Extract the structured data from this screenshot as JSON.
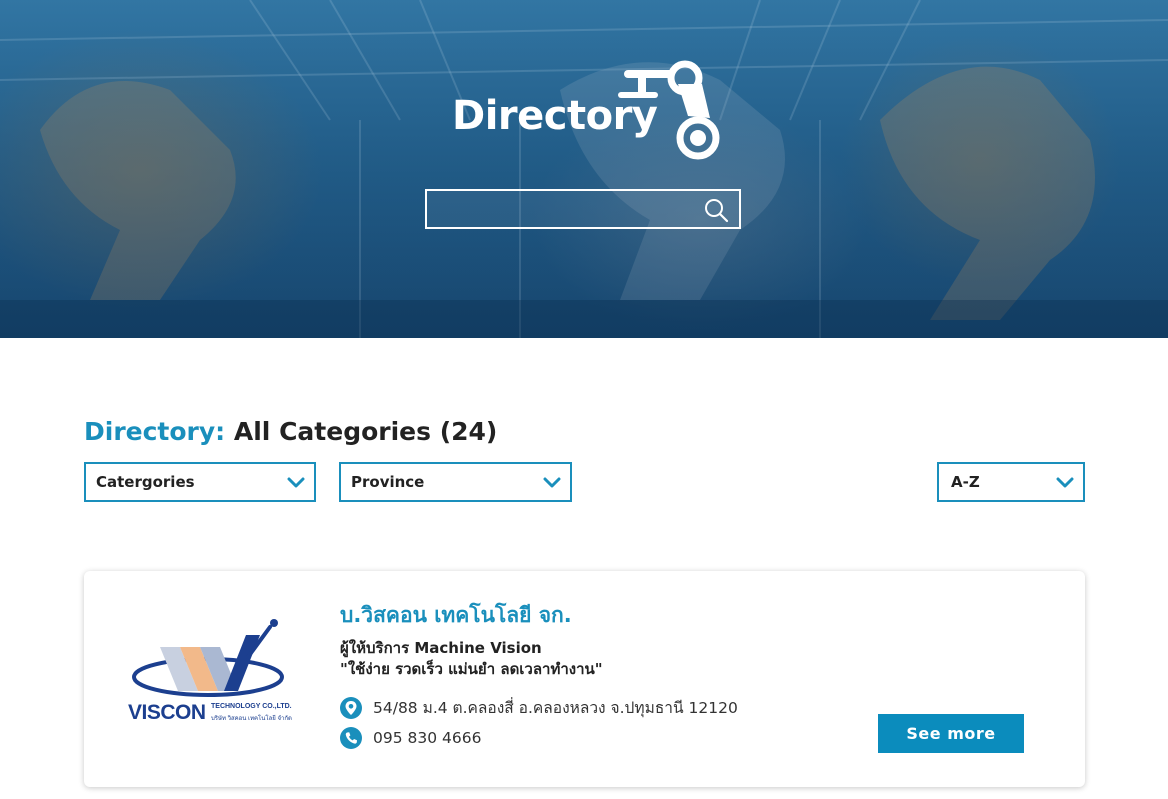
{
  "hero": {
    "title": "Directory",
    "search": {
      "value": "",
      "placeholder": ""
    }
  },
  "heading": {
    "accent": "Directory:",
    "rest": " All Categories (24)"
  },
  "filters": {
    "categories": "Catergories",
    "province": "Province",
    "sort": "A-Z"
  },
  "listings": [
    {
      "logo": {
        "brand": "VISCON",
        "sub1": "TECHNOLOGY CO.,LTD.",
        "sub2": "บริษัท วิสคอน เทคโนโลยี จำกัด"
      },
      "name": "บ.วิสคอน เทคโนโลยี จก.",
      "desc1": "ผู้ให้บริการ Machine Vision",
      "desc2": "\"ใช้ง่าย รวดเร็ว แม่นยำ ลดเวลาทำงาน\"",
      "address": "54/88 ม.4 ต.คลองสี่ อ.คลองหลวง จ.ปทุมธานี 12120",
      "phone": "095 830 4666",
      "button": "See more"
    }
  ],
  "colors": {
    "accent": "#1a8fbc",
    "button": "#0b8cbd",
    "hero_overlay": "#1d5079",
    "logo_navy": "#1c3f8f"
  },
  "icons": {
    "hero": "robot-arm-icon",
    "search": "search-icon",
    "dropdown": "chevron-down-icon",
    "address": "map-pin-icon",
    "phone": "phone-icon"
  }
}
